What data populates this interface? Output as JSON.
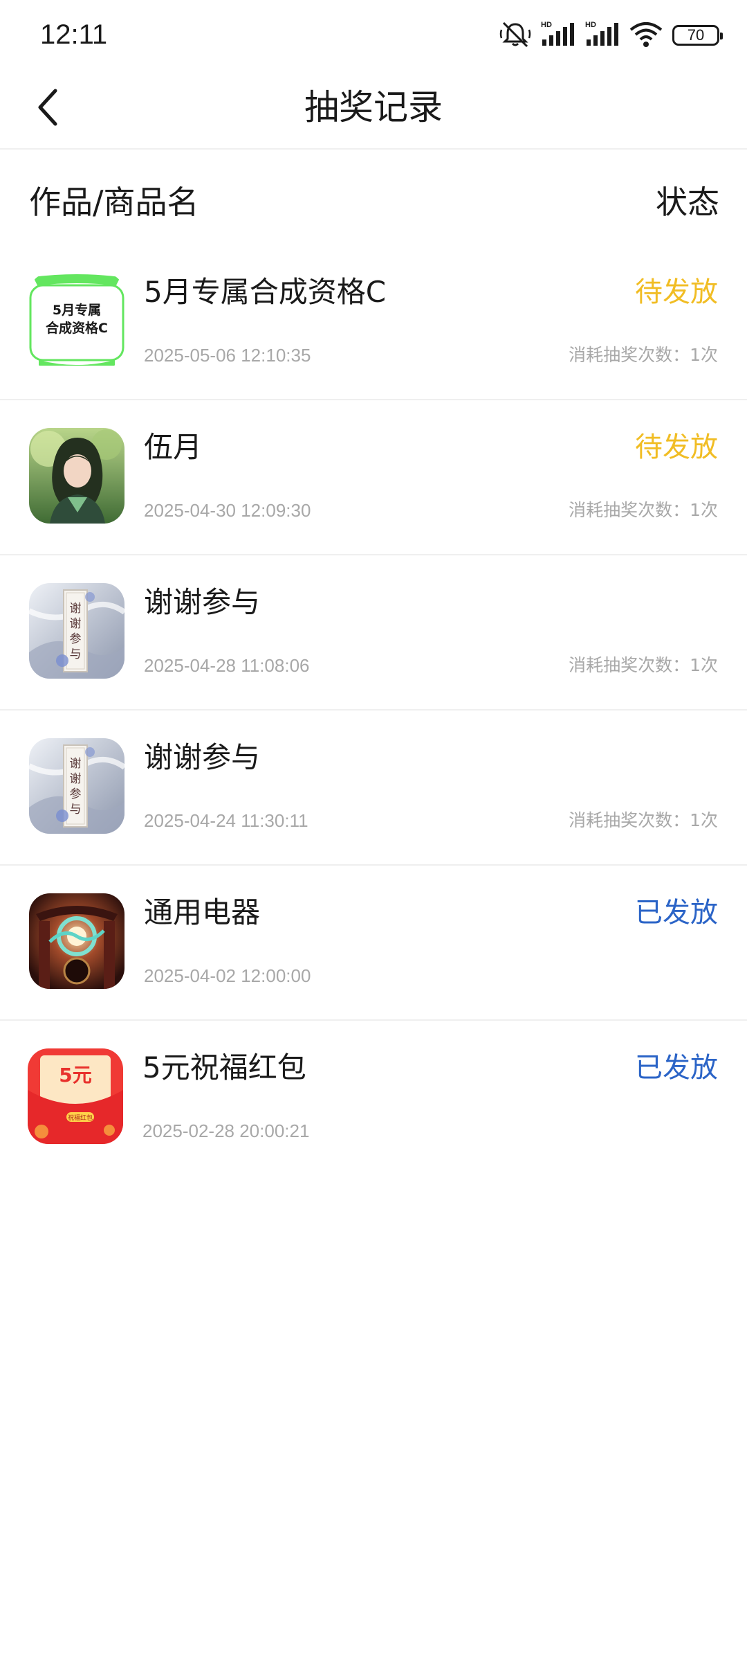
{
  "status_bar": {
    "time": "12:11",
    "battery": "70",
    "icons": [
      "mute-icon",
      "hd-signal-icon",
      "hd-signal-icon",
      "wifi-icon",
      "battery-icon"
    ]
  },
  "header": {
    "title": "抽奖记录",
    "back_icon": "chevron-left-icon"
  },
  "columns": {
    "name": "作品/商品名",
    "status": "状态"
  },
  "colors": {
    "pending": "#f1bd24",
    "issued": "#2b64c7",
    "secondary_text": "#a8a8a8",
    "divider": "#efefef"
  },
  "records": [
    {
      "name": "5月专属合成资格C",
      "date": "2025-05-06 12:10:35",
      "status": "待发放",
      "cost": "消耗抽奖次数：1次",
      "thumb": "qualification-card",
      "thumb_lines": [
        "5月专属",
        "合成资格C"
      ]
    },
    {
      "name": "伍月",
      "date": "2025-04-30 12:09:30",
      "status": "待发放",
      "cost": "消耗抽奖次数：1次",
      "thumb": "character-art"
    },
    {
      "name": "谢谢参与",
      "date": "2025-04-28 11:08:06",
      "status": "",
      "cost": "消耗抽奖次数：1次",
      "thumb": "thanks-scroll",
      "thumb_text": "谢谢参与"
    },
    {
      "name": "谢谢参与",
      "date": "2025-04-24 11:30:11",
      "status": "",
      "cost": "消耗抽奖次数：1次",
      "thumb": "thanks-scroll",
      "thumb_text": "谢谢参与"
    },
    {
      "name": "通用电器",
      "date": "2025-04-02 12:00:00",
      "status": "已发放",
      "cost": "",
      "thumb": "palace-art"
    },
    {
      "name": "5元祝福红包",
      "date": "2025-02-28 20:00:21",
      "status": "已发放",
      "cost": "",
      "thumb": "red-envelope",
      "thumb_amount": "5元",
      "thumb_badge": "祝福红包"
    }
  ]
}
